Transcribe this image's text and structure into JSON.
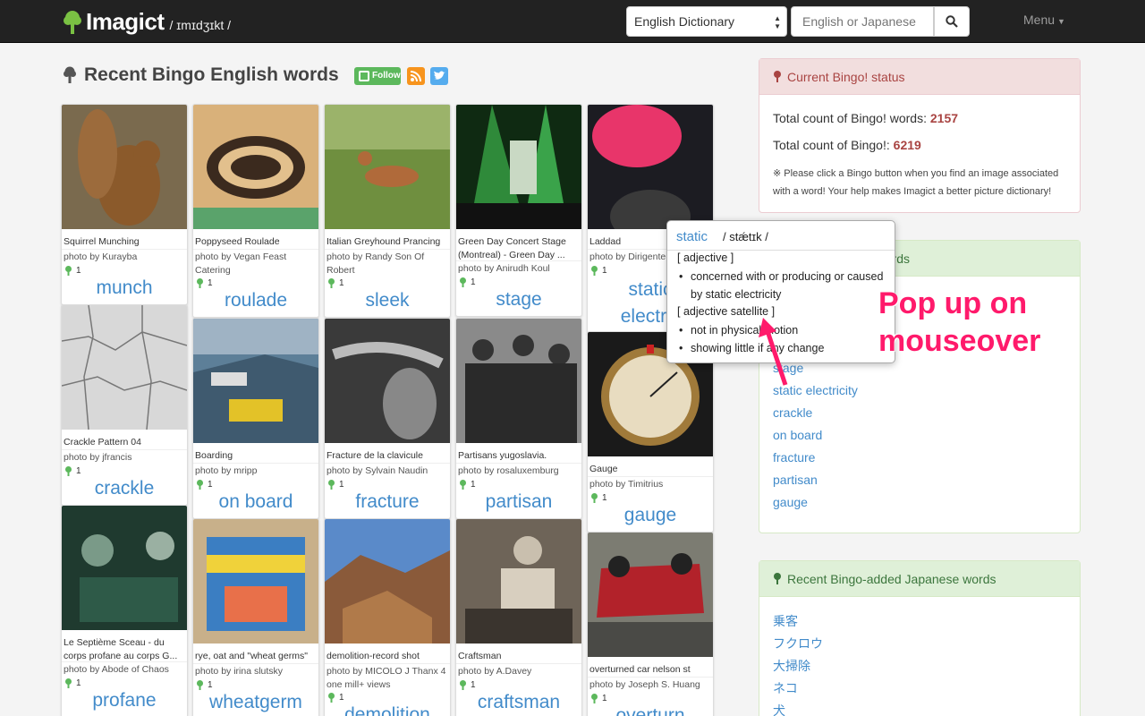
{
  "navbar": {
    "brand": "Imagict",
    "ipa": "/ ɪmɪdʒɪkt /",
    "dict_select": "English Dictionary",
    "search_placeholder": "English or Japanese",
    "menu_label": "Menu"
  },
  "main": {
    "title": "Recent Bingo English words",
    "follow_label": "Follow"
  },
  "cards": [
    {
      "caption": "Squirrel Munching",
      "credit": "photo by Kurayba",
      "bingo": "1",
      "word": "munch"
    },
    {
      "caption": "Poppyseed Roulade",
      "credit": "photo by Vegan Feast Catering",
      "bingo": "1",
      "word": "roulade"
    },
    {
      "caption": "Italian Greyhound Prancing",
      "credit": "photo by Randy Son Of Robert",
      "bingo": "1",
      "word": "sleek"
    },
    {
      "caption": "Green Day Concert Stage (Montreal) - Green Day ...",
      "credit": "photo by Anirudh Koul",
      "bingo": "1",
      "word": "stage"
    },
    {
      "caption": "Laddad",
      "credit": "photo by Dirigentens",
      "bingo": "1",
      "word1": "static",
      "word2": "electric"
    },
    {
      "caption": "Crackle Pattern 04",
      "credit": "photo by jfrancis",
      "bingo": "1",
      "word": "crackle"
    },
    {
      "caption": "Boarding",
      "credit": "photo by mripp",
      "bingo": "1",
      "word": "on board"
    },
    {
      "caption": "Fracture de la clavicule",
      "credit": "photo by Sylvain Naudin",
      "bingo": "1",
      "word": "fracture"
    },
    {
      "caption": "Partisans yugoslavia.",
      "credit": "photo by rosaluxemburg",
      "bingo": "1",
      "word": "partisan"
    },
    {
      "caption": "Gauge",
      "credit": "photo by Timitrius",
      "bingo": "1",
      "word": "gauge"
    },
    {
      "caption": "Le Septième Sceau - du corps profane au corps G...",
      "credit": "photo by Abode of Chaos",
      "bingo": "1",
      "word": "profane"
    },
    {
      "caption": "rye, oat and \"wheat germs\"",
      "credit": "photo by irina slutsky",
      "bingo": "1",
      "word": "wheatgerm"
    },
    {
      "caption": "demolition-record shot",
      "credit": "photo by MICOLO J Thanx 4 one mill+ views",
      "bingo": "1",
      "word": "demolition"
    },
    {
      "caption": "Craftsman",
      "credit": "photo by A.Davey",
      "bingo": "1",
      "word": "craftsman"
    },
    {
      "caption": "overturned car nelson st",
      "credit": "photo by Joseph S. Huang",
      "bingo": "1",
      "word": "overturn"
    }
  ],
  "status_panel": {
    "title": "Current Bingo! status",
    "words_label": "Total count of Bingo! words:",
    "words_count": "2157",
    "bingo_label": "Total count of Bingo!:",
    "bingo_count": "6219",
    "note": "※ Please click a Bingo button when you find an image associated with a word! Your help makes Imagict a better picture dictionary!"
  },
  "english_panel": {
    "title_visible": "d English words",
    "words": [
      "stage",
      "static electricity",
      "crackle",
      "on board",
      "fracture",
      "partisan",
      "gauge"
    ]
  },
  "japanese_panel": {
    "title": "Recent Bingo-added Japanese words",
    "words": [
      "乗客",
      "フクロウ",
      "大掃除",
      "ネコ",
      "犬"
    ]
  },
  "popup": {
    "word": "static",
    "ipa": "/ stǽtɪk /",
    "pos1": "[ adjective ]",
    "def1": "concerned with or producing or caused by static electricity",
    "pos2": "[ adjective satellite ]",
    "def2": "not in physical motion",
    "def3": "showing little if any change"
  },
  "annotation": {
    "line1": "Pop up on",
    "line2": "mouseover"
  },
  "colors": {
    "navbar": "#222222",
    "link": "#428bca",
    "status_number": "#a94442",
    "annotation": "#ff1a6b",
    "bingo_tree": "#5cb85c"
  }
}
